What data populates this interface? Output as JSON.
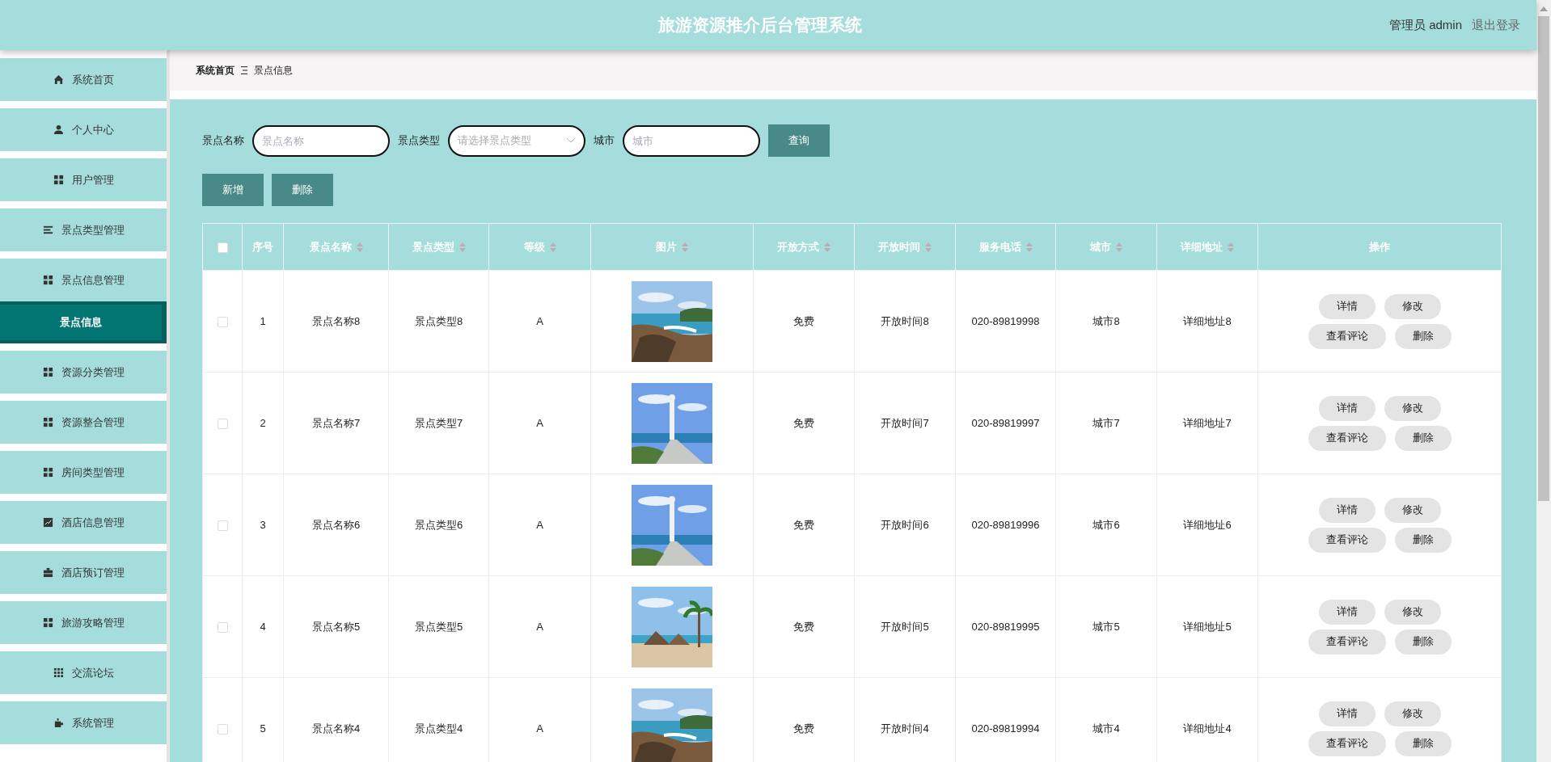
{
  "header": {
    "title": "旅游资源推介后台管理系统",
    "user": "管理员 admin",
    "logout": "退出登录"
  },
  "sidebar": {
    "items": [
      {
        "label": "系统首页",
        "selected": false
      },
      {
        "label": "个人中心",
        "selected": false
      },
      {
        "label": "用户管理",
        "selected": false
      },
      {
        "label": "景点类型管理",
        "selected": false
      },
      {
        "label": "景点信息管理",
        "selected": false,
        "children": [
          {
            "label": "景点信息",
            "selected": true
          }
        ]
      },
      {
        "label": "资源分类管理",
        "selected": false
      },
      {
        "label": "资源整合管理",
        "selected": false
      },
      {
        "label": "房间类型管理",
        "selected": false
      },
      {
        "label": "酒店信息管理",
        "selected": false
      },
      {
        "label": "酒店预订管理",
        "selected": false
      },
      {
        "label": "旅游攻略管理",
        "selected": false
      },
      {
        "label": "交流论坛",
        "selected": false
      },
      {
        "label": "系统管理",
        "selected": false
      }
    ]
  },
  "breadcrumb": [
    "系统首页",
    "景点信息"
  ],
  "search": {
    "fields": [
      {
        "label": "景点名称",
        "placeholder": "景点名称",
        "kind": "input"
      },
      {
        "label": "景点类型",
        "placeholder": "请选择景点类型",
        "kind": "select"
      },
      {
        "label": "城市",
        "placeholder": "城市",
        "kind": "input"
      }
    ],
    "query_button": "查询"
  },
  "actions": [
    "新增",
    "删除"
  ],
  "table": {
    "select_all": {
      "checked": false
    },
    "columns": [
      {
        "label": "序号",
        "sortable": false
      },
      {
        "label": "景点名称",
        "sortable": true
      },
      {
        "label": "景点类型",
        "sortable": true
      },
      {
        "label": "等级",
        "sortable": true
      },
      {
        "label": "图片",
        "sortable": true
      },
      {
        "label": "开放方式",
        "sortable": true
      },
      {
        "label": "开放时间",
        "sortable": true
      },
      {
        "label": "服务电话",
        "sortable": true
      },
      {
        "label": "城市",
        "sortable": true
      },
      {
        "label": "详细地址",
        "sortable": true
      },
      {
        "label": "操作",
        "sortable": false
      }
    ],
    "rows": [
      {
        "checked": false,
        "cells": [
          "1",
          "景点名称8",
          "景点类型8",
          "A",
          {
            "kind": "picture"
          },
          "免费",
          "开放时间8",
          "020-89819998",
          "城市8",
          "详细地址8"
        ],
        "buttons": [
          "详情",
          "修改",
          "查看评论",
          "删除"
        ]
      },
      {
        "checked": false,
        "cells": [
          "2",
          "景点名称7",
          "景点类型7",
          "A",
          {
            "kind": "picture"
          },
          "免费",
          "开放时间7",
          "020-89819997",
          "城市7",
          "详细地址7"
        ],
        "buttons": [
          "详情",
          "修改",
          "查看评论",
          "删除"
        ]
      },
      {
        "checked": false,
        "cells": [
          "3",
          "景点名称6",
          "景点类型6",
          "A",
          {
            "kind": "picture"
          },
          "免费",
          "开放时间6",
          "020-89819996",
          "城市6",
          "详细地址6"
        ],
        "buttons": [
          "详情",
          "修改",
          "查看评论",
          "删除"
        ]
      },
      {
        "checked": false,
        "cells": [
          "4",
          "景点名称5",
          "景点类型5",
          "A",
          {
            "kind": "picture"
          },
          "免费",
          "开放时间5",
          "020-89819995",
          "城市5",
          "详细地址5"
        ],
        "buttons": [
          "详情",
          "修改",
          "查看评论",
          "删除"
        ]
      },
      {
        "checked": false,
        "cells": [
          "5",
          "景点名称4",
          "景点类型4",
          "A",
          {
            "kind": "picture"
          },
          "免费",
          "开放时间4",
          "020-89819994",
          "城市4",
          "详细地址4"
        ],
        "buttons": [
          "详情",
          "修改",
          "查看评论",
          "删除"
        ]
      }
    ]
  }
}
